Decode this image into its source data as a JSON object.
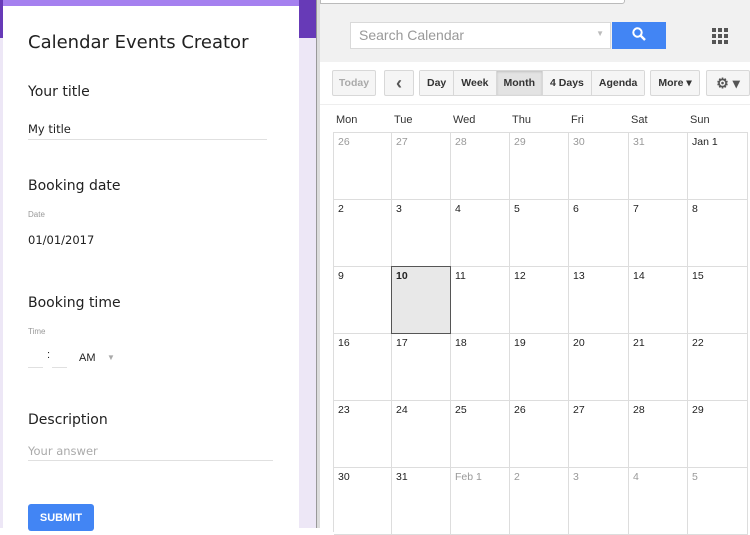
{
  "form": {
    "title": "Calendar Events Creator",
    "q1": {
      "label": "Your title",
      "value": "My title"
    },
    "q2": {
      "label": "Booking date",
      "sublabel": "Date",
      "value": "01/01/2017"
    },
    "q3": {
      "label": "Booking time",
      "sublabel": "Time",
      "separator": ":",
      "ampm": "AM"
    },
    "q4": {
      "label": "Description",
      "placeholder": "Your answer"
    },
    "submit": "SUBMIT",
    "accent": "#673ab7"
  },
  "calendar": {
    "search_placeholder": "Search Calendar",
    "toolbar": {
      "today": "Today",
      "prev": "‹",
      "views": [
        "Day",
        "Week",
        "Month",
        "4 Days",
        "Agenda"
      ],
      "selected_view": "Month",
      "more": "More ▾",
      "settings": "⚙ ▾"
    },
    "days_of_week": [
      "Mon",
      "Tue",
      "Wed",
      "Thu",
      "Fri",
      "Sat",
      "Sun"
    ],
    "weeks": [
      [
        {
          "d": "26",
          "out": true
        },
        {
          "d": "27",
          "out": true
        },
        {
          "d": "28",
          "out": true
        },
        {
          "d": "29",
          "out": true
        },
        {
          "d": "30",
          "out": true
        },
        {
          "d": "31",
          "out": true
        },
        {
          "d": "Jan 1"
        }
      ],
      [
        {
          "d": "2"
        },
        {
          "d": "3"
        },
        {
          "d": "4"
        },
        {
          "d": "5"
        },
        {
          "d": "6"
        },
        {
          "d": "7"
        },
        {
          "d": "8"
        }
      ],
      [
        {
          "d": "9"
        },
        {
          "d": "10",
          "today": true
        },
        {
          "d": "11"
        },
        {
          "d": "12"
        },
        {
          "d": "13"
        },
        {
          "d": "14"
        },
        {
          "d": "15"
        }
      ],
      [
        {
          "d": "16"
        },
        {
          "d": "17"
        },
        {
          "d": "18"
        },
        {
          "d": "19"
        },
        {
          "d": "20"
        },
        {
          "d": "21"
        },
        {
          "d": "22"
        }
      ],
      [
        {
          "d": "23"
        },
        {
          "d": "24"
        },
        {
          "d": "25"
        },
        {
          "d": "26"
        },
        {
          "d": "27"
        },
        {
          "d": "28"
        },
        {
          "d": "29"
        }
      ],
      [
        {
          "d": "30"
        },
        {
          "d": "31"
        },
        {
          "d": "Feb 1",
          "out": true
        },
        {
          "d": "2",
          "out": true
        },
        {
          "d": "3",
          "out": true
        },
        {
          "d": "4",
          "out": true
        },
        {
          "d": "5",
          "out": true
        }
      ]
    ],
    "search_color": "#4285f4"
  }
}
